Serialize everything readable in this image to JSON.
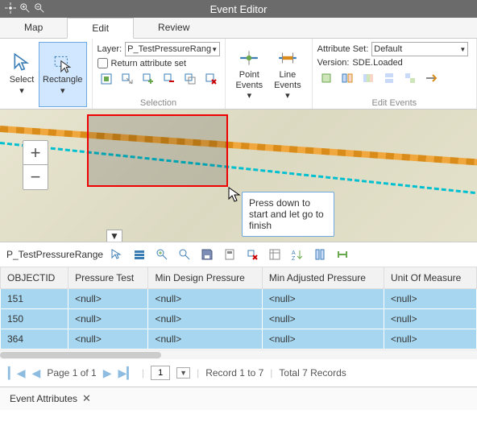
{
  "app_title": "Event Editor",
  "tabs": {
    "map": "Map",
    "edit": "Edit",
    "review": "Review",
    "active": "edit"
  },
  "ribbon": {
    "select_label": "Select",
    "rectangle_label": "Rectangle",
    "layer_label": "Layer:",
    "layer_value": "P_TestPressureRange",
    "return_attr_label": "Return attribute set",
    "selection_group_label": "Selection",
    "point_events_label": "Point\nEvents",
    "line_events_label": "Line\nEvents",
    "attr_set_label": "Attribute Set:",
    "attr_set_value": "Default",
    "version_label": "Version:",
    "version_value": "SDE.Loaded",
    "edit_events_group_label": "Edit Events"
  },
  "map": {
    "tooltip": "Press down to start and let go to finish"
  },
  "table": {
    "title": "P_TestPressureRange",
    "columns": [
      "OBJECTID",
      "Pressure Test",
      "Min Design Pressure",
      "Min Adjusted Pressure",
      "Unit Of Measure"
    ],
    "rows": [
      {
        "id": "151",
        "c1": "<null>",
        "c2": "<null>",
        "c3": "<null>",
        "c4": "<null>"
      },
      {
        "id": "150",
        "c1": "<null>",
        "c2": "<null>",
        "c3": "<null>",
        "c4": "<null>"
      },
      {
        "id": "364",
        "c1": "<null>",
        "c2": "<null>",
        "c3": "<null>",
        "c4": "<null>"
      }
    ]
  },
  "pager": {
    "page_text": "Page 1 of 1",
    "page_input": "1",
    "record_text": "Record 1 to 7",
    "total_text": "Total 7 Records"
  },
  "footer": {
    "tab_label": "Event Attributes"
  }
}
